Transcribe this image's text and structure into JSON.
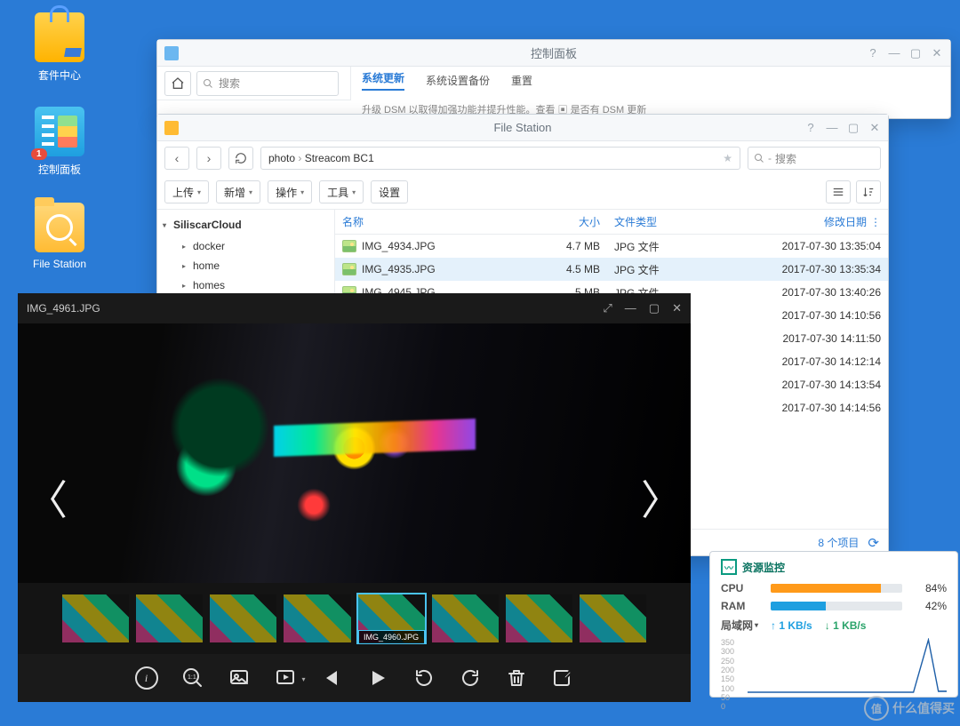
{
  "desktop": {
    "package_center": "套件中心",
    "control_panel": "控制面板",
    "control_panel_badge": "1",
    "file_station": "File Station"
  },
  "control_panel": {
    "title": "控制面板",
    "search_placeholder": "搜索",
    "tabs": {
      "update": "系统更新",
      "backup": "系统设置备份",
      "reset": "重置"
    },
    "hint": "升级 DSM 以取得加强功能并提升性能。查看 ▣ 是否有 DSM 更新"
  },
  "file_station": {
    "title": "File Station",
    "path": {
      "root": "photo",
      "folder": "Streacom BC1"
    },
    "search_placeholder": "搜索",
    "buttons": {
      "upload": "上传",
      "new": "新增",
      "action": "操作",
      "tools": "工具",
      "settings": "设置"
    },
    "tree": {
      "root": "SiliscarCloud",
      "nodes": [
        "docker",
        "home",
        "homes"
      ]
    },
    "columns": {
      "name": "名称",
      "size": "大小",
      "type": "文件类型",
      "date": "修改日期"
    },
    "rows_full": [
      {
        "name": "IMG_4934.JPG",
        "size": "4.7 MB",
        "type": "JPG 文件",
        "date": "2017-07-30 13:35:04"
      },
      {
        "name": "IMG_4935.JPG",
        "size": "4.5 MB",
        "type": "JPG 文件",
        "date": "2017-07-30 13:35:34",
        "selected": true
      },
      {
        "name": "IMG_4945.JPG",
        "size": "5 MB",
        "type": "JPG 文件",
        "date": "2017-07-30 13:40:26"
      }
    ],
    "rows_dates_only": [
      "2017-07-30 14:10:56",
      "2017-07-30 14:11:50",
      "2017-07-30 14:12:14",
      "2017-07-30 14:13:54",
      "2017-07-30 14:14:56"
    ],
    "status": {
      "count": "8 个项目"
    }
  },
  "viewer": {
    "title": "IMG_4961.JPG",
    "selected_thumb": "IMG_4960.JPG"
  },
  "resources": {
    "title": "资源监控",
    "cpu_label": "CPU",
    "cpu_pct": "84%",
    "ram_label": "RAM",
    "ram_pct": "42%",
    "net_label": "局域网",
    "up": "1 KB/s",
    "down": "1 KB/s",
    "y_ticks": [
      "350",
      "300",
      "250",
      "200",
      "150",
      "100",
      "50",
      "0"
    ]
  },
  "watermark": {
    "brand": "值",
    "text": "什么值得买"
  }
}
